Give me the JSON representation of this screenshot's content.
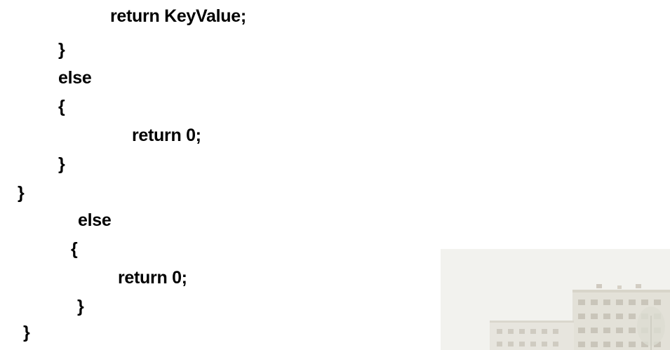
{
  "code": {
    "lines": [
      "return KeyValue;",
      "}",
      "else",
      "{",
      "return 0;",
      "}",
      "}",
      "else",
      "{",
      "return 0;",
      "}",
      "}"
    ]
  },
  "background_image": {
    "description_icon": "building-photo"
  }
}
